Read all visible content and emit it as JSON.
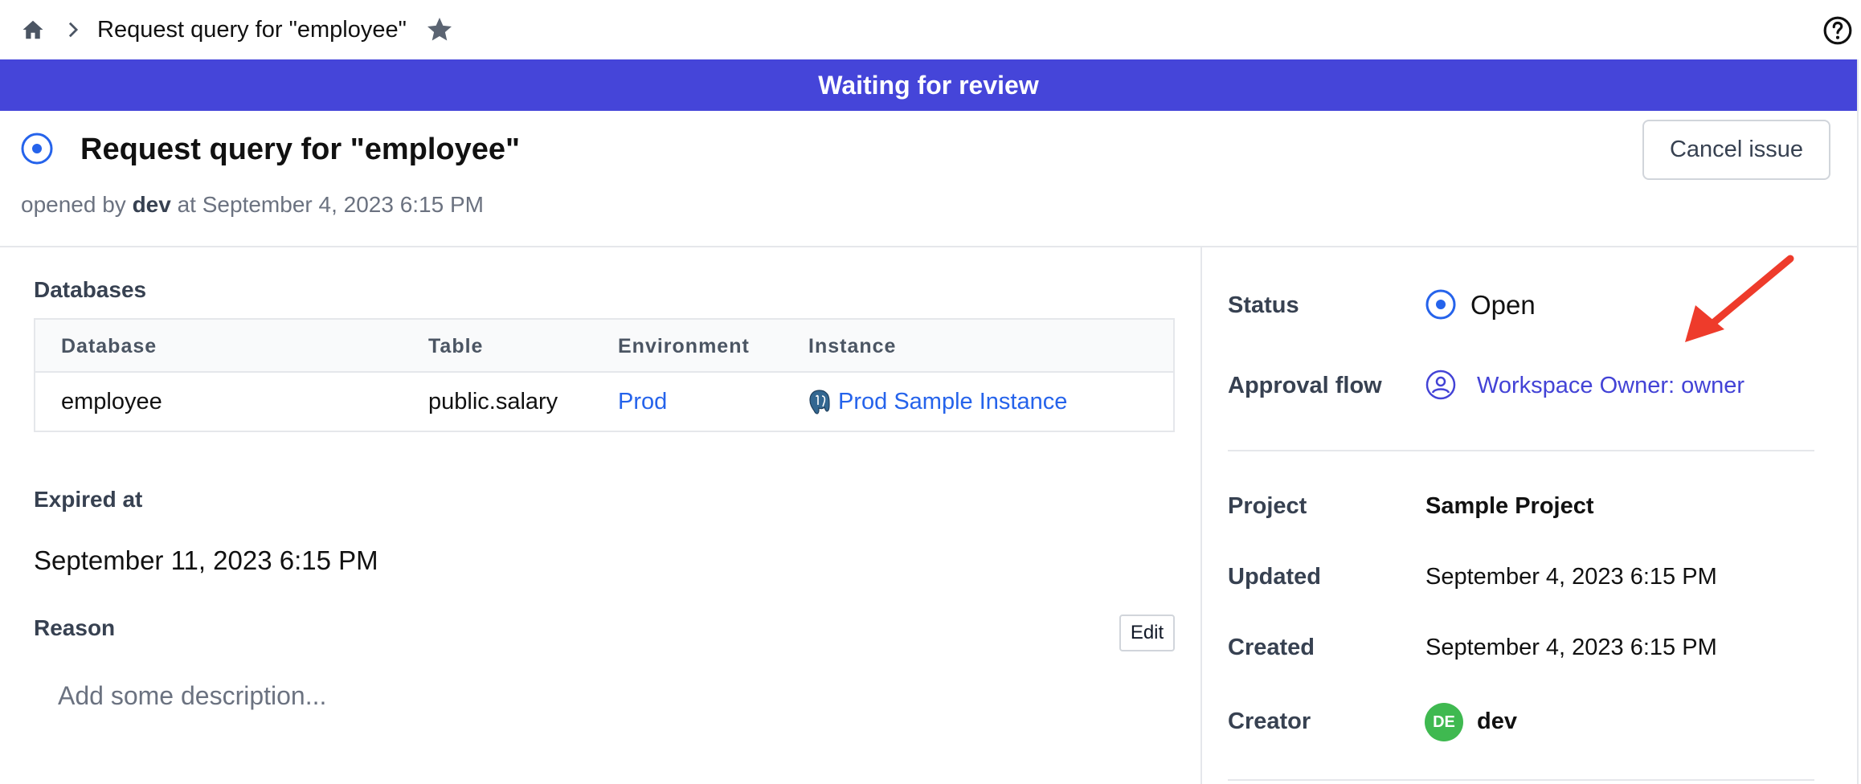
{
  "breadcrumb": {
    "title": "Request query for \"employee\""
  },
  "banner": {
    "text": "Waiting for review",
    "color": "#4545d9"
  },
  "issue": {
    "title": "Request query for \"employee\"",
    "opened_prefix": "opened by",
    "opened_by": "dev",
    "opened_at_prefix": "at",
    "opened_at": "September 4, 2023 6:15 PM",
    "cancel_label": "Cancel issue"
  },
  "databases": {
    "label": "Databases",
    "columns": [
      "Database",
      "Table",
      "Environment",
      "Instance"
    ],
    "rows": [
      {
        "database": "employee",
        "table": "public.salary",
        "environment": "Prod",
        "instance": "Prod Sample Instance"
      }
    ]
  },
  "expired": {
    "label": "Expired at",
    "value": "September 11, 2023 6:15 PM"
  },
  "reason": {
    "label": "Reason",
    "edit_label": "Edit",
    "placeholder": "Add some description..."
  },
  "sidebar": {
    "status_label": "Status",
    "status_value": "Open",
    "approval_label": "Approval flow",
    "approval_value": "Workspace Owner:  owner",
    "project_label": "Project",
    "project_value": "Sample Project",
    "updated_label": "Updated",
    "updated_value": "September 4, 2023 6:15 PM",
    "created_label": "Created",
    "created_value": "September 4, 2023 6:15 PM",
    "creator_label": "Creator",
    "creator_initials": "DE",
    "creator_name": "dev"
  },
  "colors": {
    "accent": "#4545d9",
    "link": "#2563eb",
    "avatar": "#3fb950",
    "annotation_arrow": "#ee3b2b"
  }
}
